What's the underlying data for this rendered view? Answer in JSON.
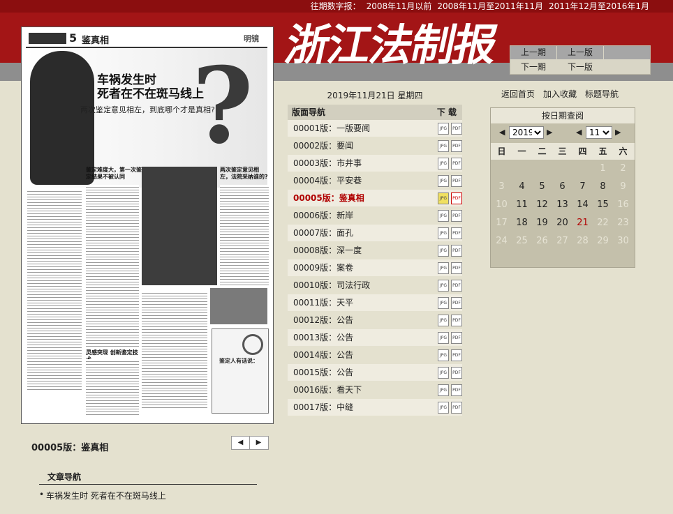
{
  "archive": {
    "label": "往期数字报：",
    "links": [
      "2008年11月以前",
      "2008年11月至2011年11月",
      "2011年12月至2016年1月"
    ]
  },
  "logo_text": "浙江法制报",
  "nav_buttons": {
    "prev_issue": "上一期",
    "prev_page": "上一版",
    "next_issue": "下一期",
    "next_page": "下一版"
  },
  "date": "2019年11月21日 星期四",
  "page_nav": {
    "title": "版面导航",
    "download": "下 载",
    "pages": [
      {
        "label": "00001版：一版要闻"
      },
      {
        "label": "00002版：要闻"
      },
      {
        "label": "00003版：市井事"
      },
      {
        "label": "00004版：平安巷"
      },
      {
        "label": "00005版：鉴真相",
        "active": true
      },
      {
        "label": "00006版：新岸"
      },
      {
        "label": "00007版：面孔"
      },
      {
        "label": "00008版：深一度"
      },
      {
        "label": "00009版：案卷"
      },
      {
        "label": "00010版：司法行政"
      },
      {
        "label": "00011版：天平"
      },
      {
        "label": "00012版：公告"
      },
      {
        "label": "00013版：公告"
      },
      {
        "label": "00014版：公告"
      },
      {
        "label": "00015版：公告"
      },
      {
        "label": "00016版：看天下"
      },
      {
        "label": "00017版：中缝"
      }
    ]
  },
  "top_links": {
    "home": "返回首页",
    "favorite": "加入收藏",
    "title_nav": "标题导航"
  },
  "calendar": {
    "title": "按日期查阅",
    "year": "2019",
    "month": "11",
    "weekdays": [
      "日",
      "一",
      "二",
      "三",
      "四",
      "五",
      "六"
    ],
    "rows": [
      [
        "",
        "",
        "",
        "",
        "",
        "1",
        "2"
      ],
      [
        "3",
        "4",
        "5",
        "6",
        "7",
        "8",
        "9"
      ],
      [
        "10",
        "11",
        "12",
        "13",
        "14",
        "15",
        "16"
      ],
      [
        "17",
        "18",
        "19",
        "20",
        "21",
        "22",
        "23"
      ],
      [
        "24",
        "25",
        "26",
        "27",
        "28",
        "29",
        "30"
      ]
    ],
    "available_days": [
      "4",
      "5",
      "6",
      "7",
      "8",
      "11",
      "12",
      "13",
      "14",
      "15",
      "18",
      "19",
      "20",
      "21"
    ],
    "highlight_day": "21"
  },
  "newspaper": {
    "page_no": "5",
    "page_name": "鉴真相",
    "column": "明镜",
    "headline_line1": "车祸发生时",
    "headline_line2": "死者在不在斑马线上",
    "subheadline": "两次鉴定意见相左，到底哪个才是真相?",
    "section_a": "鉴定难度大，第一次鉴定结果不被认同",
    "section_b": "两次鉴定意见相左，法院采纳谁的?",
    "section_c": "灵感突现 创新鉴定技术",
    "box_title": "鉴定人有话说："
  },
  "current_page_label": "00005版：鉴真相",
  "article_nav": {
    "title": "文章导航",
    "items": [
      "车祸发生时 死者在不在斑马线上"
    ]
  }
}
